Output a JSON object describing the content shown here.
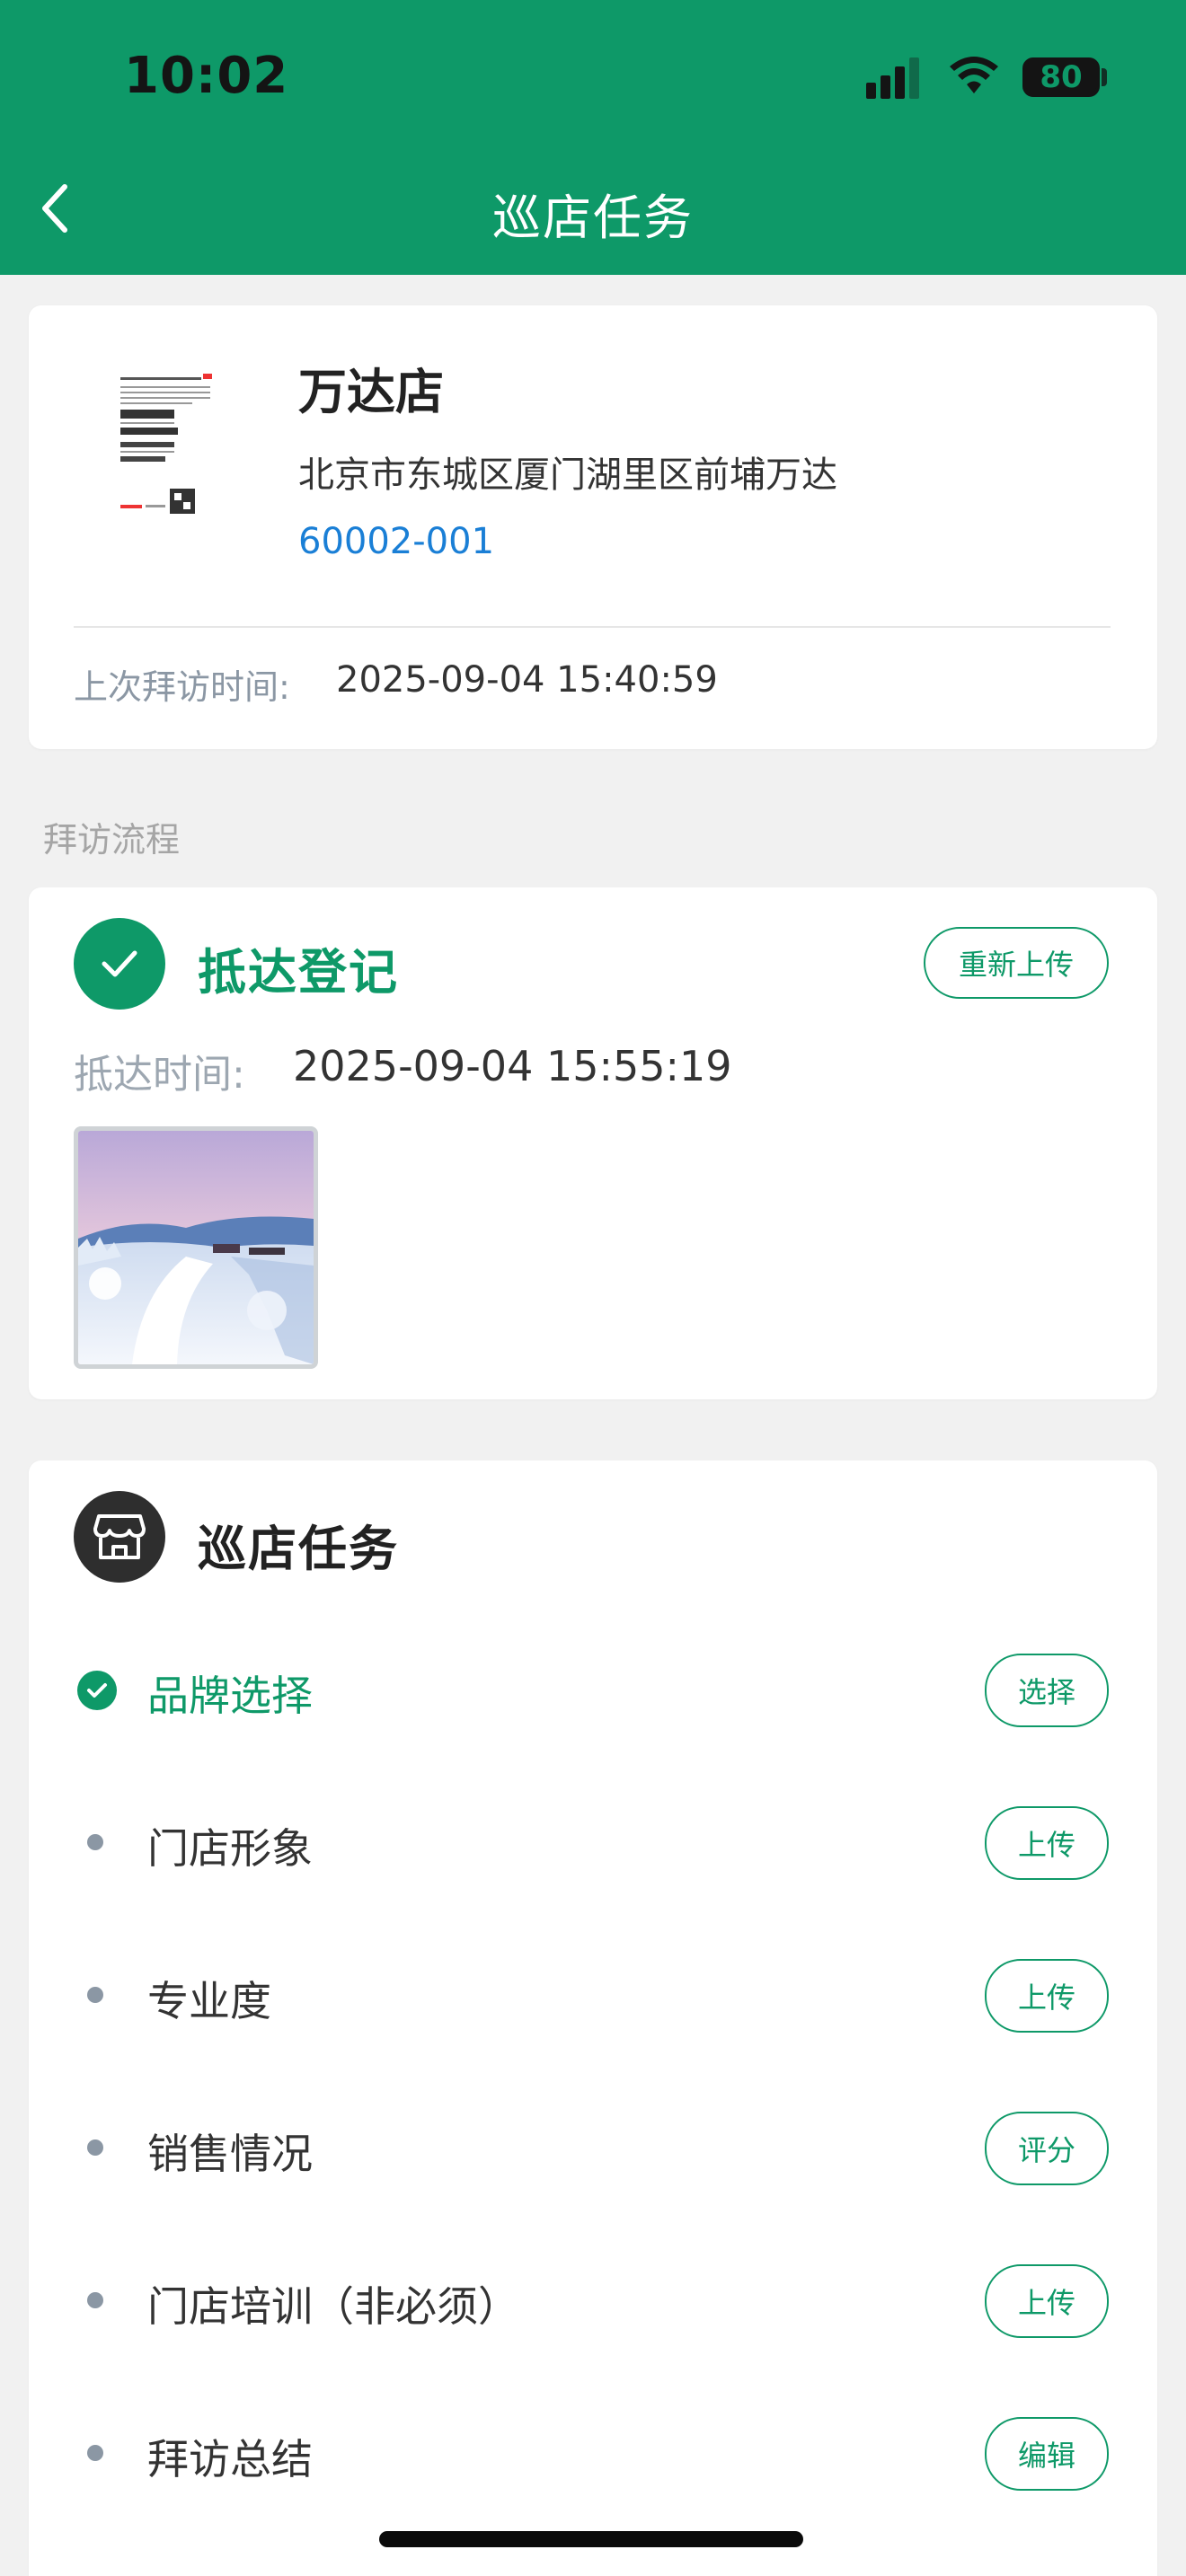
{
  "status_bar": {
    "time": "10:02",
    "battery": "80",
    "icons": [
      "signal-icon",
      "wifi-icon",
      "battery-icon"
    ]
  },
  "nav": {
    "title": "巡店任务",
    "back_icon": "chevron-left-icon"
  },
  "store": {
    "name": "万达店",
    "address": "北京市东城区厦门湖里区前埔万达",
    "code": "60002-001",
    "last_visit_label": "上次拜访时间:",
    "last_visit_value": "2025-09-04 15:40:59"
  },
  "section_label": "拜访流程",
  "arrival": {
    "title": "抵达登记",
    "reupload_label": "重新上传",
    "time_label": "抵达时间:",
    "time_value": "2025-09-04 15:55:19"
  },
  "tasks": {
    "title": "巡店任务",
    "items": [
      {
        "label": "品牌选择",
        "action": "选择",
        "status": "done"
      },
      {
        "label": "门店形象",
        "action": "上传",
        "status": "pending"
      },
      {
        "label": "专业度",
        "action": "上传",
        "status": "pending"
      },
      {
        "label": "销售情况",
        "action": "评分",
        "status": "pending"
      },
      {
        "label": "门店培训（非必须）",
        "action": "上传",
        "status": "pending"
      },
      {
        "label": "拜访总结",
        "action": "编辑",
        "status": "pending"
      }
    ]
  },
  "colors": {
    "primary": "#0e9968",
    "link": "#1a7fd6",
    "muted": "#8b97a4",
    "background": "#f1f1f1"
  }
}
